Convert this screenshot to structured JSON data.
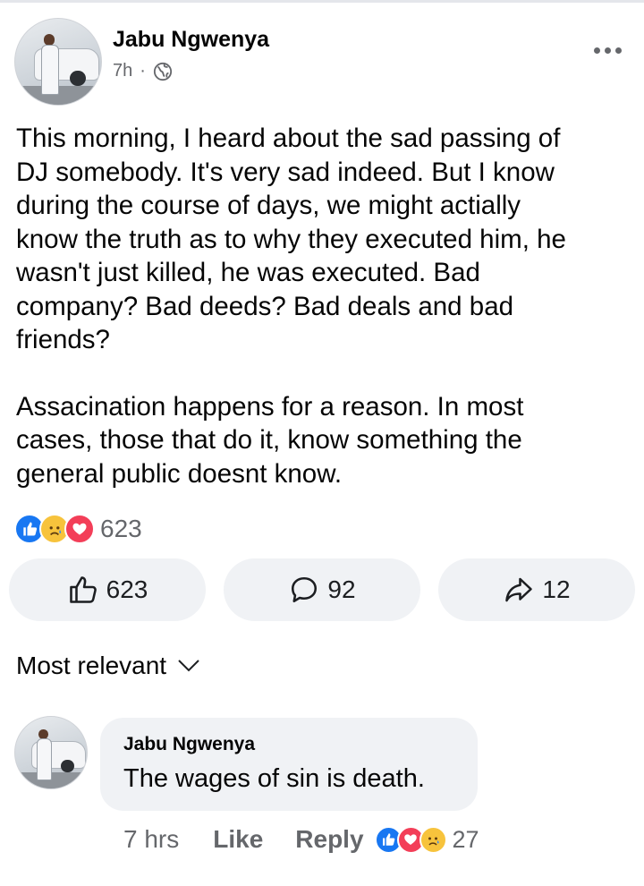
{
  "post": {
    "author": "Jabu Ngwenya",
    "time": "7h",
    "separator": "·",
    "paragraphs": [
      "This morning, I heard about the sad passing of\nDJ somebody. It's very sad indeed. But I know\nduring the course of days, we might actially\nknow the truth as to why they executed him, he\nwasn't just killed, he was executed. Bad\ncompany? Bad deeds? Bad deals and bad\nfriends?",
      "Assacination happens for a reason. In most\ncases, those that do it, know something the\ngeneral public doesnt know."
    ],
    "reaction_total": "623",
    "reaction_icons": [
      "like-icon",
      "sad-icon",
      "love-icon"
    ]
  },
  "actions": {
    "like_count": "623",
    "comment_count": "92",
    "share_count": "12"
  },
  "sort_label": "Most relevant",
  "comment": {
    "author": "Jabu Ngwenya",
    "text": "The wages of sin is death.",
    "time": "7 hrs",
    "like_label": "Like",
    "reply_label": "Reply",
    "reaction_count": "27",
    "reaction_icons": [
      "like-icon",
      "love-icon",
      "sad-icon"
    ]
  },
  "colors": {
    "like_blue": "#1877f2",
    "love_red": "#f33e58",
    "sad_yellow": "#f7c33c",
    "secondary_text": "#65676b",
    "pill_bg": "#f0f2f5"
  }
}
